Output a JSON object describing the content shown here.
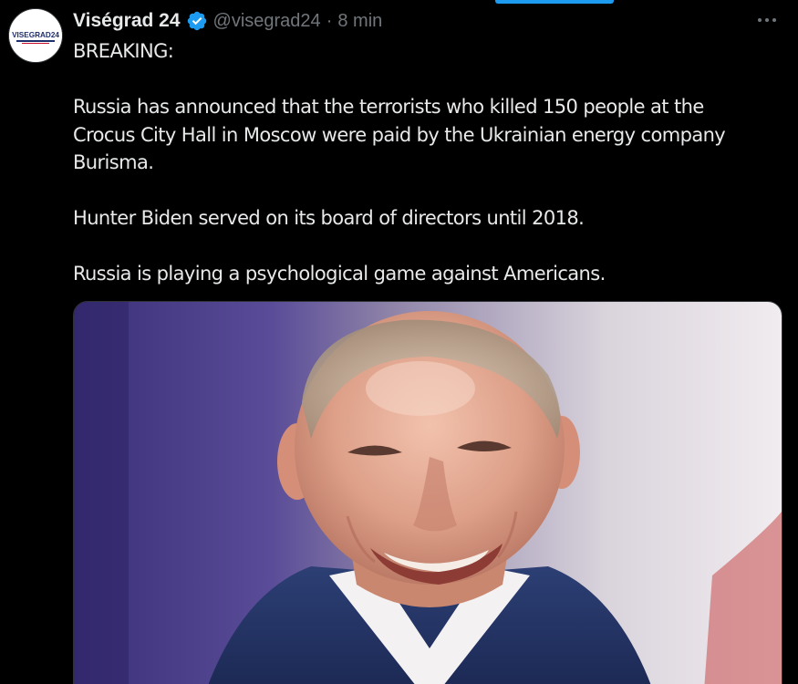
{
  "author": {
    "display_name": "Viségrad 24",
    "handle": "@visegrad24",
    "separator": "·",
    "time": "8 min",
    "avatar_text": "VISEGRAD24",
    "verified_icon": "verified-badge-icon",
    "verified_color": "#1d9bf0"
  },
  "tweet": {
    "lines": [
      "BREAKING:",
      "Russia has announced that the terrorists who killed 150 people at the Crocus City Hall in Moscow were paid by the Ukrainian energy company Burisma.",
      "Hunter Biden served on its board of directors until 2018.",
      "Russia is playing a psychological game against Americans."
    ]
  },
  "media": {
    "type": "photo",
    "subject": "man-in-suit-smiling"
  },
  "colors": {
    "background": "#000000",
    "text_primary": "#e7e9ea",
    "text_secondary": "#71767b",
    "accent": "#1d9bf0"
  },
  "icons": {
    "more": "more-horizontal-icon"
  }
}
